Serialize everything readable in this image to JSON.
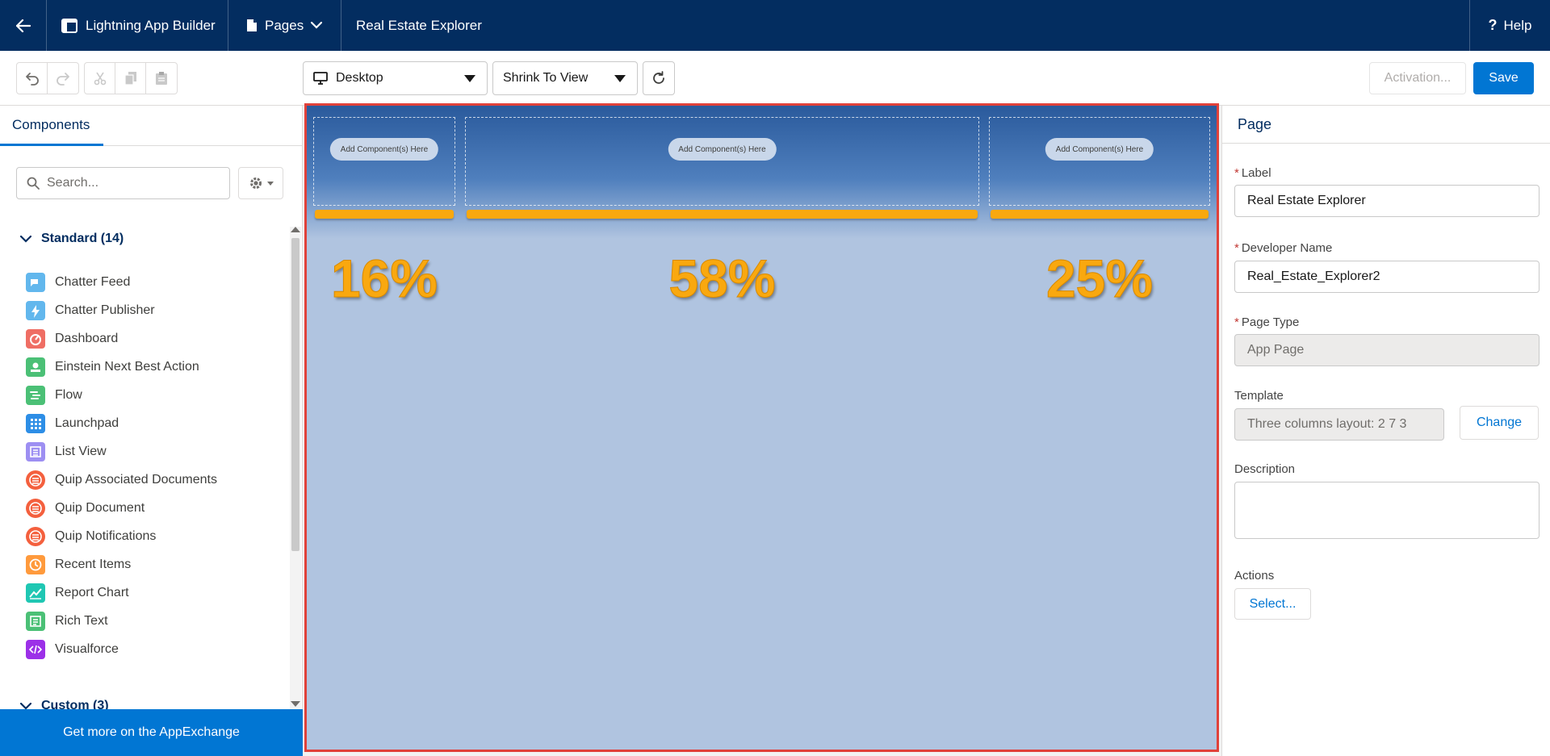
{
  "topbar": {
    "app_name": "Lightning App Builder",
    "pages_label": "Pages",
    "page_title": "Real Estate Explorer",
    "help_label": "Help"
  },
  "toolbar": {
    "device_select": "Desktop",
    "view_select": "Shrink To View",
    "activation_label": "Activation...",
    "save_label": "Save"
  },
  "left_panel": {
    "tab_label": "Components",
    "search_placeholder": "Search...",
    "standard_header": "Standard (14)",
    "custom_header": "Custom (3)",
    "components": [
      {
        "label": "Chatter Feed",
        "icon": "chatter-feed-icon",
        "color": "#62b7ed"
      },
      {
        "label": "Chatter Publisher",
        "icon": "lightning-bolt-icon",
        "color": "#62b7ed"
      },
      {
        "label": "Dashboard",
        "icon": "dashboard-gauge-icon",
        "color": "#ef6e64"
      },
      {
        "label": "Einstein Next Best Action",
        "icon": "einstein-icon",
        "color": "#4bc076"
      },
      {
        "label": "Flow",
        "icon": "flow-icon",
        "color": "#4bc076"
      },
      {
        "label": "Launchpad",
        "icon": "app-grid-icon",
        "color": "#2d8ee6"
      },
      {
        "label": "List View",
        "icon": "list-icon",
        "color": "#9d8ff2"
      },
      {
        "label": "Quip Associated Documents",
        "icon": "quip-icon",
        "color": "#f4603e"
      },
      {
        "label": "Quip Document",
        "icon": "quip-icon",
        "color": "#f4603e"
      },
      {
        "label": "Quip Notifications",
        "icon": "quip-icon",
        "color": "#f4603e"
      },
      {
        "label": "Recent Items",
        "icon": "clock-icon",
        "color": "#ff9a3c"
      },
      {
        "label": "Report Chart",
        "icon": "line-chart-icon",
        "color": "#1fc7b3"
      },
      {
        "label": "Rich Text",
        "icon": "rich-text-icon",
        "color": "#4bc076"
      },
      {
        "label": "Visualforce",
        "icon": "code-icon",
        "color": "#9c30e8"
      }
    ],
    "appexchange_label": "Get more on the AppExchange"
  },
  "canvas": {
    "add_component_label": "Add Component(s) Here",
    "column_widths": [
      {
        "label": "16%",
        "fraction": 0.16
      },
      {
        "label": "58%",
        "fraction": 0.58
      },
      {
        "label": "25%",
        "fraction": 0.25
      }
    ]
  },
  "right_panel": {
    "header": "Page",
    "label_field": {
      "label": "Label",
      "value": "Real Estate Explorer"
    },
    "dev_name_field": {
      "label": "Developer Name",
      "value": "Real_Estate_Explorer2"
    },
    "page_type_field": {
      "label": "Page Type",
      "value": "App Page"
    },
    "template_field": {
      "label": "Template",
      "value": "Three columns layout: 2 7 3",
      "change_label": "Change"
    },
    "description_field": {
      "label": "Description",
      "value": ""
    },
    "actions_field": {
      "label": "Actions",
      "select_label": "Select..."
    },
    "required_marker": "*"
  },
  "colors": {
    "nav_bg": "#032d60",
    "brand_blue": "#0176d3",
    "canvas_outline": "#e0413a",
    "column_accent": "#f9a80f"
  }
}
